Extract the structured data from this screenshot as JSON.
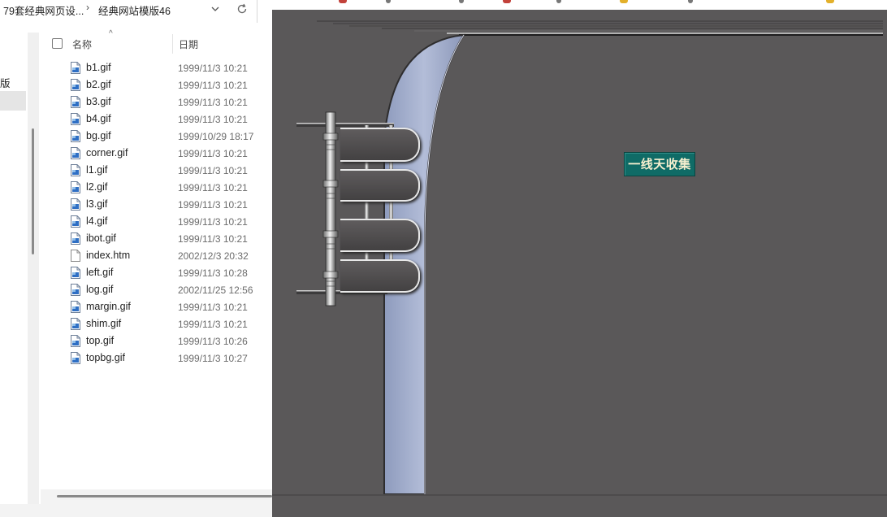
{
  "explorer": {
    "breadcrumb": {
      "parent": "79套经典网页设...",
      "separator": "›",
      "current": "经典网站模版46"
    },
    "nav_pane": {
      "visible_text": "版"
    },
    "columns": {
      "name": "名称",
      "date": "日期"
    },
    "files": [
      {
        "name": "b1.gif",
        "date": "1999/11/3 10:21",
        "icon": "image-file-icon"
      },
      {
        "name": "b2.gif",
        "date": "1999/11/3 10:21",
        "icon": "image-file-icon"
      },
      {
        "name": "b3.gif",
        "date": "1999/11/3 10:21",
        "icon": "image-file-icon"
      },
      {
        "name": "b4.gif",
        "date": "1999/11/3 10:21",
        "icon": "image-file-icon"
      },
      {
        "name": "bg.gif",
        "date": "1999/10/29 18:17",
        "icon": "image-file-icon"
      },
      {
        "name": "corner.gif",
        "date": "1999/11/3 10:21",
        "icon": "image-file-icon"
      },
      {
        "name": "l1.gif",
        "date": "1999/11/3 10:21",
        "icon": "image-file-icon"
      },
      {
        "name": "l2.gif",
        "date": "1999/11/3 10:21",
        "icon": "image-file-icon"
      },
      {
        "name": "l3.gif",
        "date": "1999/11/3 10:21",
        "icon": "image-file-icon"
      },
      {
        "name": "l4.gif",
        "date": "1999/11/3 10:21",
        "icon": "image-file-icon"
      },
      {
        "name": "ibot.gif",
        "date": "1999/11/3 10:21",
        "icon": "image-file-icon"
      },
      {
        "name": "index.htm",
        "date": "2002/12/3 20:32",
        "icon": "document-file-icon"
      },
      {
        "name": "left.gif",
        "date": "1999/11/3 10:28",
        "icon": "image-file-icon"
      },
      {
        "name": "log.gif",
        "date": "2002/11/25 12:56",
        "icon": "image-file-icon"
      },
      {
        "name": "margin.gif",
        "date": "1999/11/3 10:21",
        "icon": "image-file-icon"
      },
      {
        "name": "shim.gif",
        "date": "1999/11/3 10:21",
        "icon": "image-file-icon"
      },
      {
        "name": "top.gif",
        "date": "1999/11/3 10:26",
        "icon": "image-file-icon"
      },
      {
        "name": "topbg.gif",
        "date": "1999/11/3 10:27",
        "icon": "image-file-icon"
      }
    ]
  },
  "browser": {
    "page": {
      "background_color": "#5a5859",
      "frame_accent_color": "#a8b4d0",
      "button_label": "一线天收集",
      "button_color": "#0f6b66",
      "button_text_color": "#f6efcf",
      "nav_tab_count": 4
    }
  }
}
